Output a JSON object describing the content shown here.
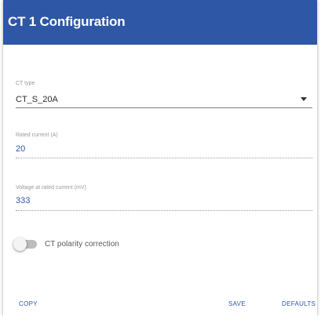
{
  "dialog": {
    "title": "CT 1 Configuration",
    "header_color": "#2e57a5",
    "ct_type": {
      "label": "CT type",
      "value": "CT_S_20A"
    },
    "rated_current": {
      "label": "Rated current (A)",
      "value": "20"
    },
    "voltage": {
      "label": "Voltage at rated current (mV)",
      "value": "333"
    },
    "polarity": {
      "label": "CT polarity correction",
      "enabled": false
    },
    "actions": {
      "copy": "COPY",
      "save": "SAVE",
      "defaults": "DEFAULTS"
    }
  }
}
